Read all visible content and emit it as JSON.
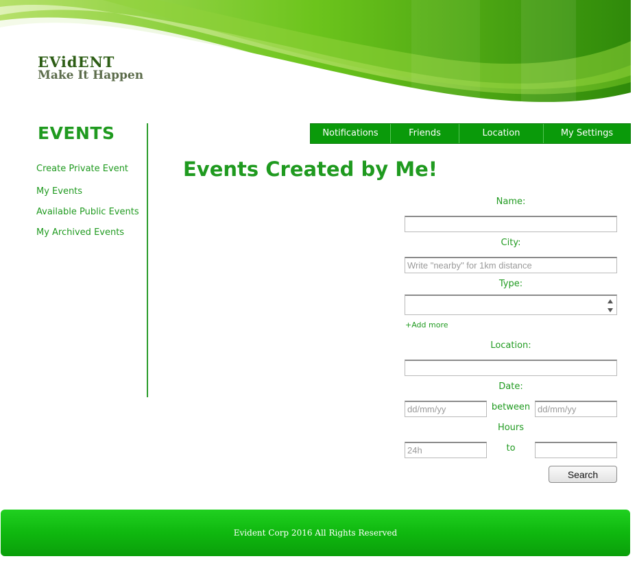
{
  "header": {
    "brand": "EVidENT",
    "tagline": "Make It Happen"
  },
  "sidebar": {
    "heading": "EVENTS",
    "items": [
      {
        "label": "Create Private Event"
      },
      {
        "label": "My Events"
      },
      {
        "label": "Available Public Events"
      },
      {
        "label": "My Archived Events"
      }
    ]
  },
  "nav": {
    "items": [
      {
        "label": "Notifications"
      },
      {
        "label": "Friends"
      },
      {
        "label": "Location"
      },
      {
        "label": "My Settings"
      }
    ]
  },
  "main": {
    "title": "Events Created by Me!"
  },
  "form": {
    "name_label": "Name:",
    "name_value": "",
    "city_label": "City:",
    "city_placeholder": "Write \"nearby\" for 1km distance",
    "type_label": "Type:",
    "add_more": "+Add more",
    "location_label": "Location:",
    "location_value": "",
    "date_label": "Date:",
    "date_between": "between",
    "date_from_placeholder": "dd/mm/yy",
    "date_to_placeholder": "dd/mm/yy",
    "hours_label": "Hours",
    "hours_to": "to",
    "hours_from_placeholder": "24h",
    "hours_to_value": "",
    "search_label": "Search"
  },
  "footer": {
    "text": "Evident Corp  2016 All Rights Reserved"
  },
  "colors": {
    "accent": "#1f9a1f",
    "nav_bg": "#0a9a0a",
    "footer_bg": "#12b812"
  }
}
